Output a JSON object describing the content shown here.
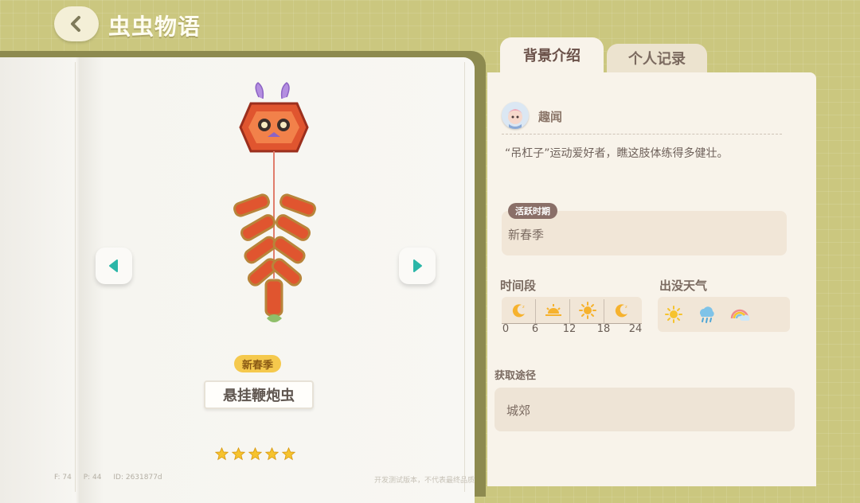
{
  "header": {
    "title": "虫虫物语",
    "back_icon": "chevron-left-icon"
  },
  "left_page": {
    "prev_icon": "triangle-left-icon",
    "next_icon": "triangle-right-icon",
    "season_badge": "新春季",
    "bug_name": "悬挂鞭炮虫",
    "rarity_stars": 5,
    "debug": {
      "fps": "F: 74",
      "ping": "P: 44",
      "id": "ID: 2631877d"
    },
    "footer_note": "开发测试版本，不代表最终品质"
  },
  "tabs": [
    {
      "label": "背景介绍",
      "active": true
    },
    {
      "label": "个人记录",
      "active": false
    }
  ],
  "info": {
    "trivia_label": "趣闻",
    "trivia_text": "“吊杠子”运动爱好者，瞧这肢体练得多健壮。",
    "active_period_label": "活跃时期",
    "active_period_value": "新春季",
    "time_label": "时间段",
    "time_icons": [
      "moon-icon",
      "sunrise-icon",
      "sun-icon",
      "moon-icon"
    ],
    "time_ticks": [
      "0",
      "6",
      "12",
      "18",
      "24"
    ],
    "weather_label": "出没天气",
    "weather_icons": [
      "sunny-icon",
      "rain-icon",
      "rainbow-icon"
    ],
    "acquire_label": "获取途径",
    "acquire_value": "城郊"
  },
  "colors": {
    "accent": "#2bb6a8",
    "star": "#f6c32e",
    "badge": "#f5c94d"
  }
}
